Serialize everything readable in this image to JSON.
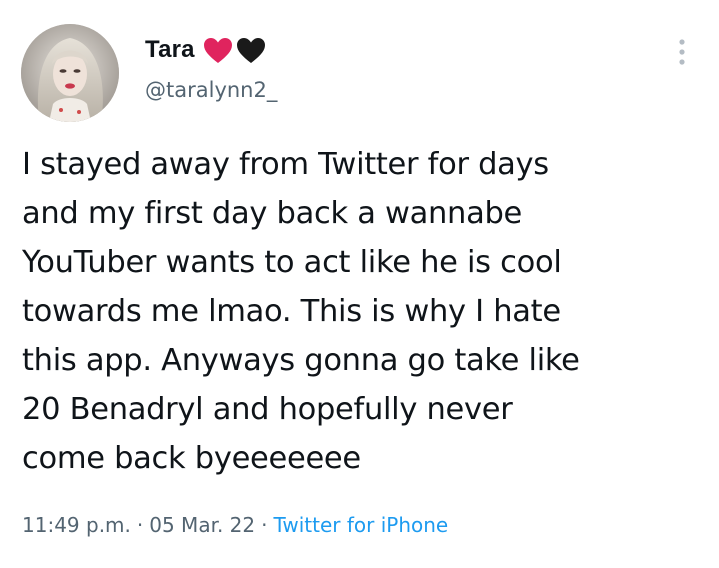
{
  "author": {
    "display_name": "Tara",
    "handle": "@taralynn2_",
    "badges": [
      "red-heart-icon",
      "black-heart-icon"
    ],
    "badge_colors": {
      "red": "#e0245e",
      "black": "#1a1a1a"
    }
  },
  "tweet": {
    "text": "I stayed away from Twitter for days\nand my first day back a wannabe\nYouTuber wants to act like he is cool\ntowards me lmao. This is why I hate\nthis app. Anyways gonna go take like\n20 Benadryl and hopefully never\ncome back byeeeeeee"
  },
  "meta": {
    "time": "11:49 p.m.",
    "separator": "·",
    "date": "05 Mar. 22",
    "source": "Twitter for iPhone"
  },
  "colors": {
    "text": "#0f1419",
    "secondary": "#536471",
    "link": "#1d9bf0"
  },
  "icons": {
    "more": "more-vertical-icon",
    "avatar": "avatar"
  }
}
